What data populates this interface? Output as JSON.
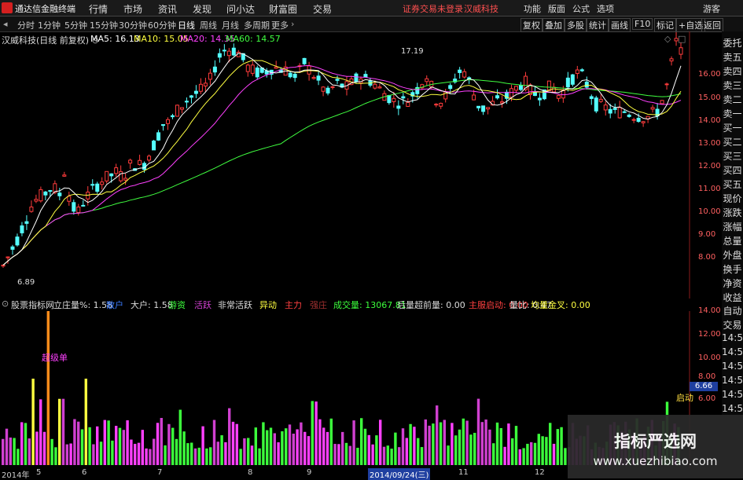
{
  "menu": {
    "app_title": "通达信金融终端",
    "items": [
      "行情",
      "市场",
      "资讯",
      "发现",
      "问小达",
      "财富圈",
      "交易"
    ],
    "notice1": "证券交易未登录",
    "notice2": "汉威科技",
    "right_items": [
      "功能",
      "版面",
      "公式",
      "选项"
    ],
    "guest": "游客"
  },
  "toolbar": {
    "periods": [
      "分时",
      "1分钟",
      "5分钟",
      "15分钟",
      "30分钟",
      "60分钟",
      "日线",
      "周线",
      "月线",
      "多周期",
      "更多"
    ],
    "buttons": [
      "复权",
      "叠加",
      "多股",
      "统计",
      "画线",
      "F10",
      "标记",
      "+自选",
      "返回"
    ]
  },
  "main": {
    "title": "汉威科技(日线 前复权)",
    "ma5": "MA5: 16.13",
    "ma10": "MA10: 15.05",
    "ma20": "MA20: 14.35",
    "ma60": "MA60: 14.57",
    "high_label": "17.19",
    "low_label": "6.89",
    "prices": [
      "16.00",
      "15.00",
      "14.00",
      "13.00",
      "12.00",
      "11.00",
      "10.00",
      "9.00",
      "8.00"
    ],
    "ref_price": "6.66"
  },
  "indicator": {
    "name": "股票指标网",
    "items": [
      {
        "t": "立庄量%: 1.58",
        "c": "#dddddd"
      },
      {
        "t": "散户",
        "c": "#3a7bff"
      },
      {
        "t": "大户: 1.58",
        "c": "#dddddd"
      },
      {
        "t": "游资",
        "c": "#3cff3c"
      },
      {
        "t": "活跃",
        "c": "#d040d0"
      },
      {
        "t": "非常活跃",
        "c": "#dddddd"
      },
      {
        "t": "异动",
        "c": "#ffff40"
      },
      {
        "t": "主力",
        "c": "#ff4040"
      },
      {
        "t": "强庄",
        "c": "#a03030"
      },
      {
        "t": "成交量: 13067.81",
        "c": "#3cff3c"
      },
      {
        "t": "后量超前量: 0.00",
        "c": "#dddddd"
      },
      {
        "t": "主服启动: 0.00",
        "c": "#ff4040"
      },
      {
        "t": "量比: 0.47",
        "c": "#dddddd"
      },
      {
        "t": "均量金叉: 0.00",
        "c": "#ffff40"
      }
    ],
    "tag_super": "超级单",
    "tag_start": "启动",
    "yticks": [
      "14.00",
      "12.00",
      "10.00",
      "8.00",
      "6.00"
    ]
  },
  "sidebar": {
    "top": [
      "委托",
      "卖五",
      "卖四",
      "卖三",
      "卖二",
      "卖一",
      "买一",
      "买二",
      "买三",
      "买四",
      "买五",
      "现价",
      "涨跌",
      "涨幅",
      "总量",
      "外盘",
      "换手",
      "净资",
      "收益"
    ],
    "bottom": [
      "自动",
      "交易",
      "14:5",
      "14:5",
      "14:5",
      "14:5",
      "14:5",
      "14:5"
    ]
  },
  "timeaxis": {
    "labels": [
      "2014年",
      "5",
      "6",
      "7",
      "8",
      "9",
      "2014/09/24(三)",
      "11",
      "12"
    ]
  },
  "watermark": {
    "line1": "指标严选网",
    "line2": "www.xuezhibiao.com"
  },
  "colors": {
    "up": "#ff3c3c",
    "down": "#54ffff",
    "ma5": "#ffffff",
    "ma10": "#ffff40",
    "ma20": "#ff40ff",
    "ma60": "#40ff40"
  }
}
